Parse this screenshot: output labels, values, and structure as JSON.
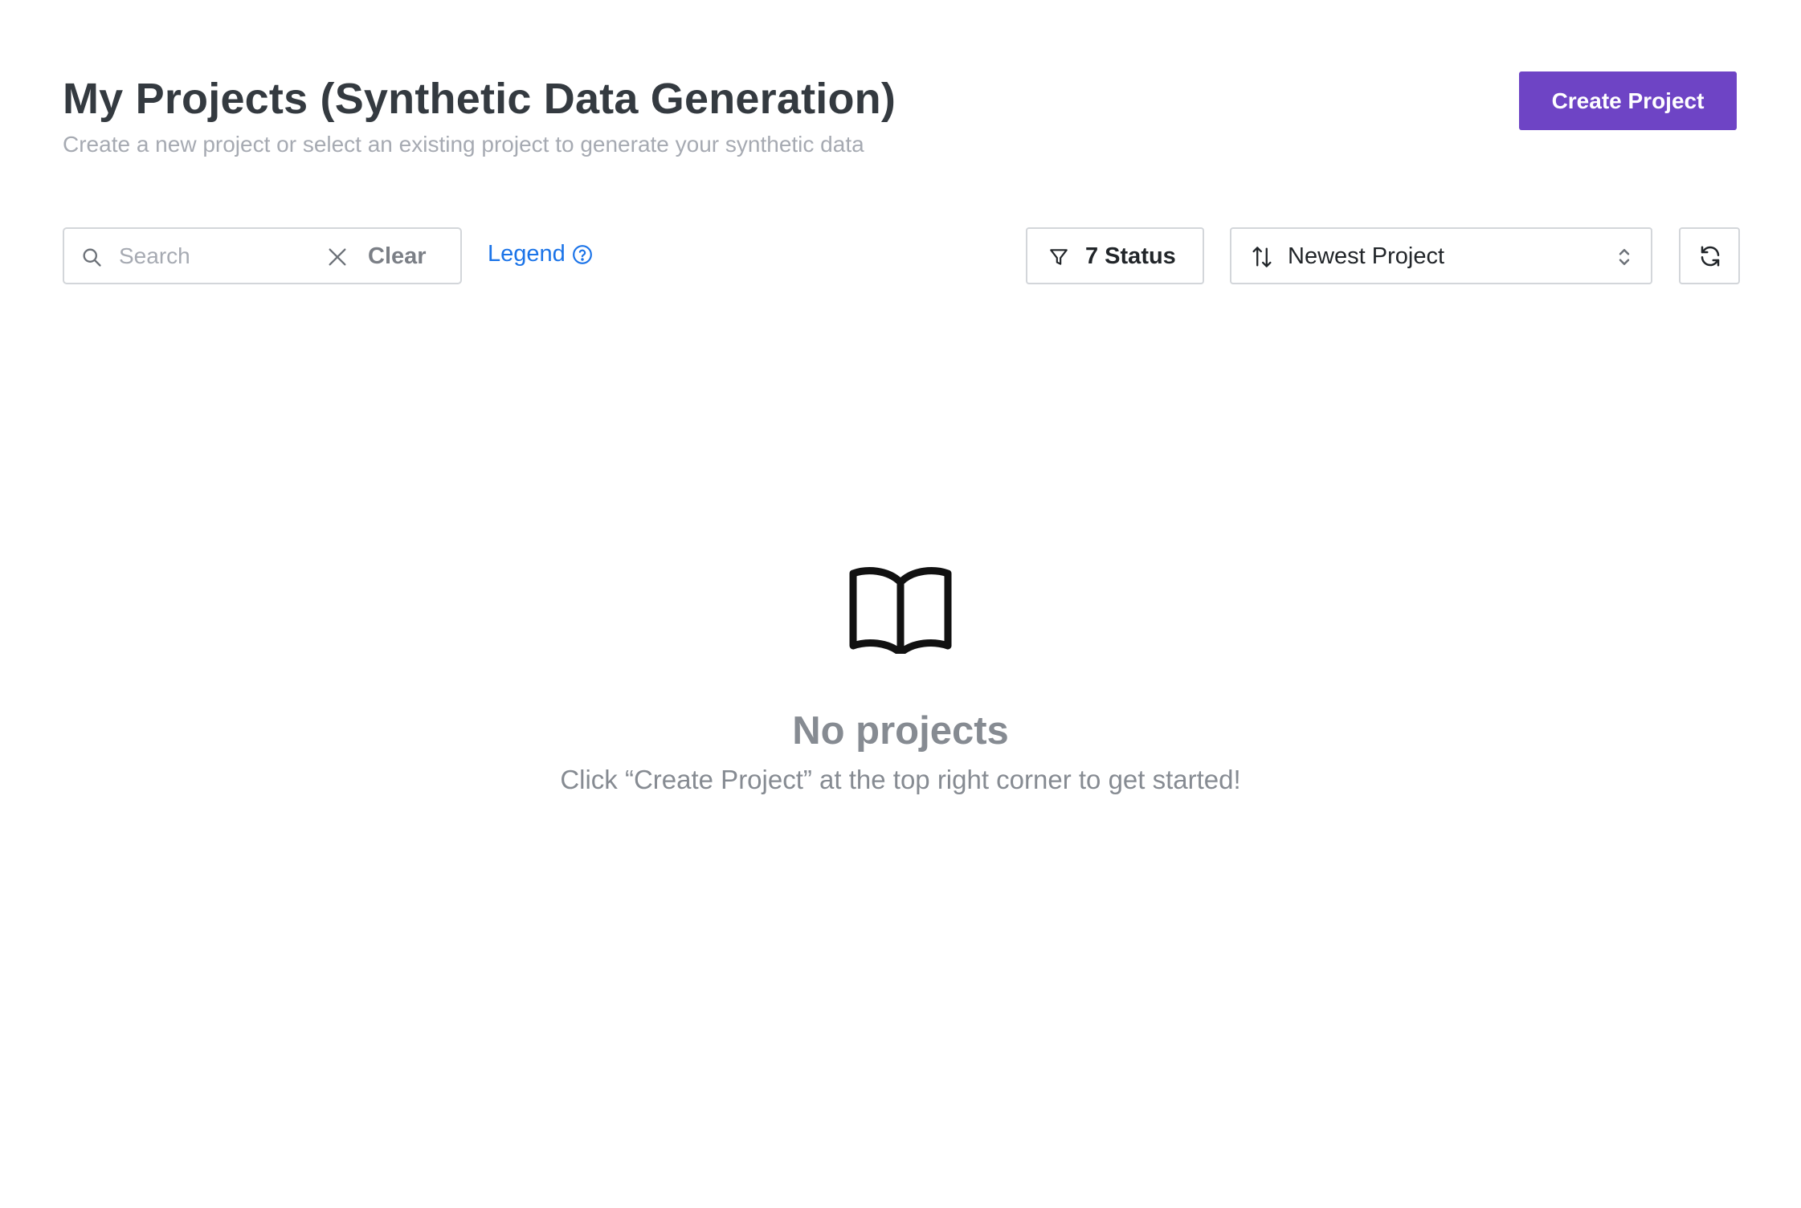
{
  "header": {
    "title": "My Projects (Synthetic Data Generation)",
    "subtitle": "Create a new project or select an existing project to generate your synthetic data",
    "create_button_label": "Create Project",
    "accent_color": "#6e44c5"
  },
  "toolbar": {
    "search": {
      "placeholder": "Search",
      "value": "",
      "clear_label": "Clear",
      "icon": "search-icon",
      "clear_icon": "close-icon"
    },
    "legend": {
      "label": "Legend",
      "icon": "help-circle-icon",
      "color": "#1a73e8"
    },
    "status_filter": {
      "label": "7 Status",
      "icon": "filter-icon"
    },
    "sort": {
      "selected": "Newest Project",
      "icon": "sort-icon",
      "chevron_icon": "chevron-updown-icon"
    },
    "refresh": {
      "icon": "refresh-icon"
    }
  },
  "empty_state": {
    "icon": "book-open-icon",
    "title": "No projects",
    "message": "Click “Create Project” at the top right corner to get started!"
  }
}
